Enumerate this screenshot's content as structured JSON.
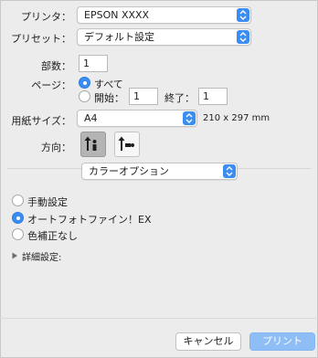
{
  "printer": {
    "label": "プリンタ：",
    "value": "EPSON XXXX"
  },
  "preset": {
    "label": "プリセット：",
    "value": "デフォルト設定"
  },
  "copies": {
    "label": "部数：",
    "value": "1"
  },
  "pages": {
    "label": "ページ：",
    "all_label": "すべて",
    "from_label": "開始：",
    "from_value": "1",
    "to_label": "終了：",
    "to_value": "1"
  },
  "paper_size": {
    "label": "用紙サイズ：",
    "value": "A4",
    "dimensions": "210 x 297 mm"
  },
  "orientation": {
    "label": "方向：",
    "portrait_icon": "portrait-orientation-icon",
    "landscape_icon": "landscape-orientation-icon"
  },
  "section_popup": {
    "value": "カラーオプション"
  },
  "color_options": [
    {
      "label": "手動設定",
      "selected": false
    },
    {
      "label": "オートフォトファイン！EX",
      "selected": true
    },
    {
      "label": "色補正なし",
      "selected": false
    }
  ],
  "advanced": {
    "label": "詳細設定:"
  },
  "buttons": {
    "cancel": "キャンセル",
    "print": "プリント"
  },
  "colors": {
    "accent": "#3b8df2",
    "print_button": "#8fbef7"
  }
}
